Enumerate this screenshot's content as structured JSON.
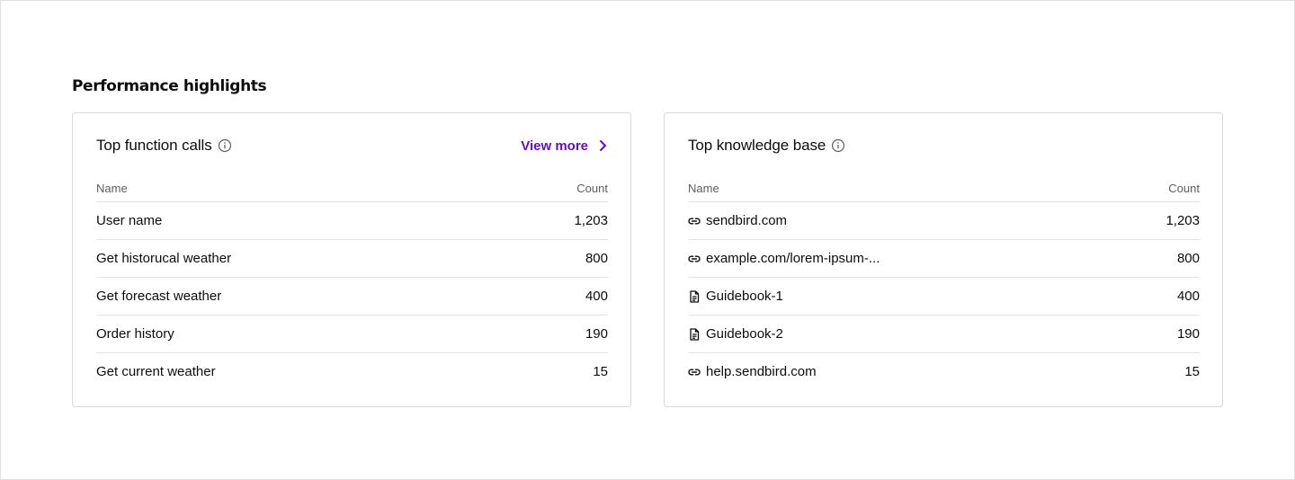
{
  "section": {
    "title": "Performance highlights"
  },
  "function_calls": {
    "title": "Top function calls",
    "view_more_label": "View more",
    "columns": {
      "name": "Name",
      "count": "Count"
    },
    "rows": [
      {
        "name": "User name",
        "count": "1,203"
      },
      {
        "name": "Get historucal weather",
        "count": "800"
      },
      {
        "name": "Get forecast weather",
        "count": "400"
      },
      {
        "name": "Order history",
        "count": "190"
      },
      {
        "name": "Get current weather",
        "count": "15"
      }
    ]
  },
  "knowledge_base": {
    "title": "Top knowledge base",
    "columns": {
      "name": "Name",
      "count": "Count"
    },
    "rows": [
      {
        "icon": "link-icon",
        "name": "sendbird.com",
        "count": "1,203"
      },
      {
        "icon": "link-icon",
        "name": "example.com/lorem-ipsum-...",
        "count": "800"
      },
      {
        "icon": "document-icon",
        "name": "Guidebook-1",
        "count": "400"
      },
      {
        "icon": "document-icon",
        "name": "Guidebook-2",
        "count": "190"
      },
      {
        "icon": "link-icon",
        "name": "help.sendbird.com",
        "count": "15"
      }
    ]
  },
  "colors": {
    "accent": "#6210cc",
    "border": "#d9d9d9",
    "divider": "#e3e3e3",
    "text_primary": "#0d0d0d",
    "text_secondary": "#5e5e5e"
  }
}
